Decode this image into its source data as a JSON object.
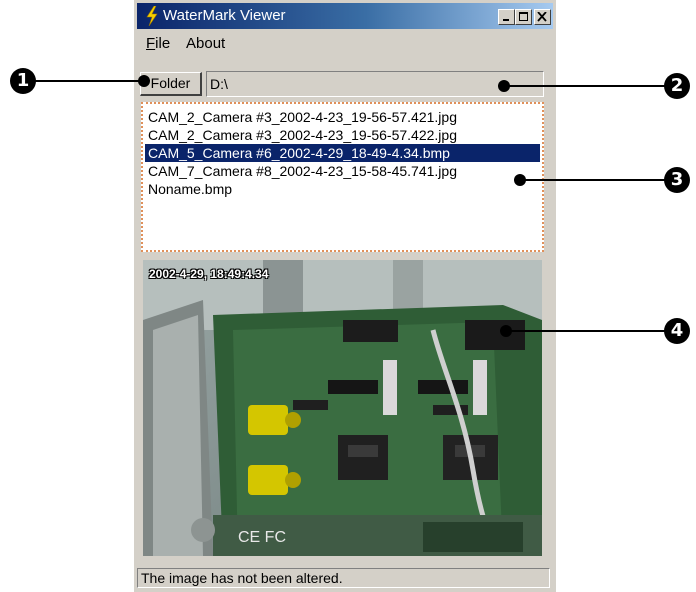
{
  "window": {
    "title": "WaterMark Viewer"
  },
  "menu": {
    "file": "File",
    "about": "About"
  },
  "toolbar": {
    "folder_label": "Folder",
    "path": "D:\\"
  },
  "files": [
    {
      "name": "CAM_2_Camera #3_2002-4-23_19-56-57.421.jpg",
      "selected": false
    },
    {
      "name": "CAM_2_Camera #3_2002-4-23_19-56-57.422.jpg",
      "selected": false
    },
    {
      "name": "CAM_5_Camera #6_2002-4-29_18-49-4.34.bmp",
      "selected": true
    },
    {
      "name": "CAM_7_Camera #8_2002-4-23_15-58-45.741.jpg",
      "selected": false
    },
    {
      "name": "Noname.bmp",
      "selected": false
    }
  ],
  "image": {
    "timestamp": "2002-4-29, 18:49:4.34"
  },
  "status": {
    "text": "The image has not been altered."
  },
  "callouts": [
    "1",
    "2",
    "3",
    "4"
  ],
  "colors": {
    "title_bar": "#0a246a",
    "selection": "#0a246a",
    "list_border": "#e0905a",
    "window": "#d4d0c8"
  }
}
